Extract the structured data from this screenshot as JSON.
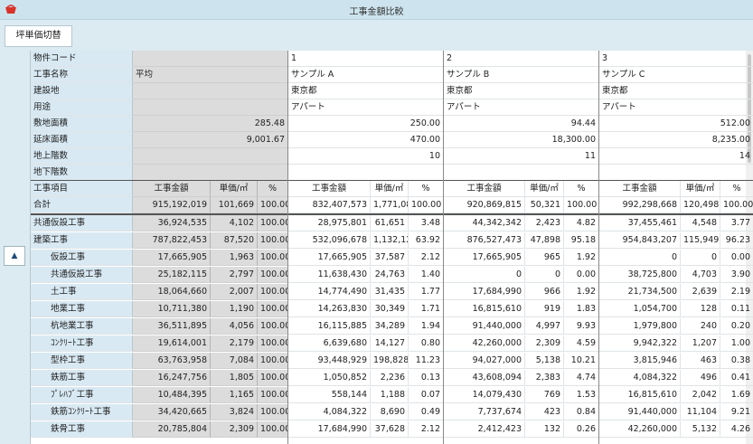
{
  "window": {
    "title": "工事金額比較"
  },
  "toolbar": {
    "switch_label": "坪単価切替"
  },
  "toggle": {
    "glyph": "▲"
  },
  "colors": {
    "label_bg": "#d8e9f3",
    "avg_bg": "#dcdcdc",
    "window_bg": "#dcebf2"
  },
  "info": {
    "rows": [
      {
        "label": "物件コード",
        "avg": "",
        "p1": "1",
        "p2": "2",
        "p3": "3",
        "align": "left"
      },
      {
        "label": "工事名称",
        "avg": "平均",
        "p1": "サンプル A",
        "p2": "サンプル B",
        "p3": "サンプル C",
        "align": "left"
      },
      {
        "label": "建設地",
        "avg": "",
        "p1": "東京都",
        "p2": "東京都",
        "p3": "東京都",
        "align": "left"
      },
      {
        "label": "用途",
        "avg": "",
        "p1": "アパート",
        "p2": "アパート",
        "p3": "アパート",
        "align": "left"
      },
      {
        "label": "敷地面積",
        "avg": "285.48",
        "p1": "250.00",
        "p2": "94.44",
        "p3": "512.00",
        "align": "right"
      },
      {
        "label": "延床面積",
        "avg": "9,001.67",
        "p1": "470.00",
        "p2": "18,300.00",
        "p3": "8,235.00",
        "align": "right"
      },
      {
        "label": "地上階数",
        "avg": "",
        "p1": "10",
        "p2": "11",
        "p3": "14",
        "align": "right"
      },
      {
        "label": "地下階数",
        "avg": "",
        "p1": "",
        "p2": "",
        "p3": "",
        "align": "right"
      }
    ]
  },
  "header": {
    "item": "工事項目",
    "amount": "工事金額",
    "unit": "単価/㎡",
    "pct": "%"
  },
  "total": {
    "label": "合計",
    "avg": [
      "915,192,019",
      "101,669",
      "100.00"
    ],
    "p1": [
      "832,407,573",
      "1,771,080",
      "100.00"
    ],
    "p2": [
      "920,869,815",
      "50,321",
      "100.00"
    ],
    "p3": [
      "992,298,668",
      "120,498",
      "100.00"
    ]
  },
  "items": [
    {
      "label": "共通仮設工事",
      "sub": false,
      "avg": [
        "36,924,535",
        "4,102",
        "100.00"
      ],
      "p1": [
        "28,975,801",
        "61,651",
        "3.48"
      ],
      "p2": [
        "44,342,342",
        "2,423",
        "4.82"
      ],
      "p3": [
        "37,455,461",
        "4,548",
        "3.77"
      ]
    },
    {
      "label": "建築工事",
      "sub": false,
      "avg": [
        "787,822,453",
        "87,520",
        "100.00"
      ],
      "p1": [
        "532,096,678",
        "1,132,121",
        "63.92"
      ],
      "p2": [
        "876,527,473",
        "47,898",
        "95.18"
      ],
      "p3": [
        "954,843,207",
        "115,949",
        "96.23"
      ]
    },
    {
      "label": "仮設工事",
      "sub": true,
      "avg": [
        "17,665,905",
        "1,963",
        "100.00"
      ],
      "p1": [
        "17,665,905",
        "37,587",
        "2.12"
      ],
      "p2": [
        "17,665,905",
        "965",
        "1.92"
      ],
      "p3": [
        "0",
        "0",
        "0.00"
      ]
    },
    {
      "label": "共通仮設工事",
      "sub": true,
      "avg": [
        "25,182,115",
        "2,797",
        "100.00"
      ],
      "p1": [
        "11,638,430",
        "24,763",
        "1.40"
      ],
      "p2": [
        "0",
        "0",
        "0.00"
      ],
      "p3": [
        "38,725,800",
        "4,703",
        "3.90"
      ]
    },
    {
      "label": "土工事",
      "sub": true,
      "avg": [
        "18,064,660",
        "2,007",
        "100.00"
      ],
      "p1": [
        "14,774,490",
        "31,435",
        "1.77"
      ],
      "p2": [
        "17,684,990",
        "966",
        "1.92"
      ],
      "p3": [
        "21,734,500",
        "2,639",
        "2.19"
      ]
    },
    {
      "label": "地業工事",
      "sub": true,
      "avg": [
        "10,711,380",
        "1,190",
        "100.00"
      ],
      "p1": [
        "14,263,830",
        "30,349",
        "1.71"
      ],
      "p2": [
        "16,815,610",
        "919",
        "1.83"
      ],
      "p3": [
        "1,054,700",
        "128",
        "0.11"
      ]
    },
    {
      "label": "杭地業工事",
      "sub": true,
      "avg": [
        "36,511,895",
        "4,056",
        "100.00"
      ],
      "p1": [
        "16,115,885",
        "34,289",
        "1.94"
      ],
      "p2": [
        "91,440,000",
        "4,997",
        "9.93"
      ],
      "p3": [
        "1,979,800",
        "240",
        "0.20"
      ]
    },
    {
      "label": "ｺﾝｸﾘｰﾄ工事",
      "sub": true,
      "avg": [
        "19,614,001",
        "2,179",
        "100.00"
      ],
      "p1": [
        "6,639,680",
        "14,127",
        "0.80"
      ],
      "p2": [
        "42,260,000",
        "2,309",
        "4.59"
      ],
      "p3": [
        "9,942,322",
        "1,207",
        "1.00"
      ]
    },
    {
      "label": "型枠工事",
      "sub": true,
      "avg": [
        "63,763,958",
        "7,084",
        "100.00"
      ],
      "p1": [
        "93,448,929",
        "198,828",
        "11.23"
      ],
      "p2": [
        "94,027,000",
        "5,138",
        "10.21"
      ],
      "p3": [
        "3,815,946",
        "463",
        "0.38"
      ]
    },
    {
      "label": "鉄筋工事",
      "sub": true,
      "avg": [
        "16,247,756",
        "1,805",
        "100.00"
      ],
      "p1": [
        "1,050,852",
        "2,236",
        "0.13"
      ],
      "p2": [
        "43,608,094",
        "2,383",
        "4.74"
      ],
      "p3": [
        "4,084,322",
        "496",
        "0.41"
      ]
    },
    {
      "label": "ﾌﾟﾚﾊﾌﾞ工事",
      "sub": true,
      "avg": [
        "10,484,395",
        "1,165",
        "100.00"
      ],
      "p1": [
        "558,144",
        "1,188",
        "0.07"
      ],
      "p2": [
        "14,079,430",
        "769",
        "1.53"
      ],
      "p3": [
        "16,815,610",
        "2,042",
        "1.69"
      ]
    },
    {
      "label": "鉄筋ｺﾝｸﾘｰﾄ工事",
      "sub": true,
      "avg": [
        "34,420,665",
        "3,824",
        "100.00"
      ],
      "p1": [
        "4,084,322",
        "8,690",
        "0.49"
      ],
      "p2": [
        "7,737,674",
        "423",
        "0.84"
      ],
      "p3": [
        "91,440,000",
        "11,104",
        "9.21"
      ]
    },
    {
      "label": "鉄骨工事",
      "sub": true,
      "avg": [
        "20,785,804",
        "2,309",
        "100.00"
      ],
      "p1": [
        "17,684,990",
        "37,628",
        "2.12"
      ],
      "p2": [
        "2,412,423",
        "132",
        "0.26"
      ],
      "p3": [
        "42,260,000",
        "5,132",
        "4.26"
      ]
    }
  ]
}
